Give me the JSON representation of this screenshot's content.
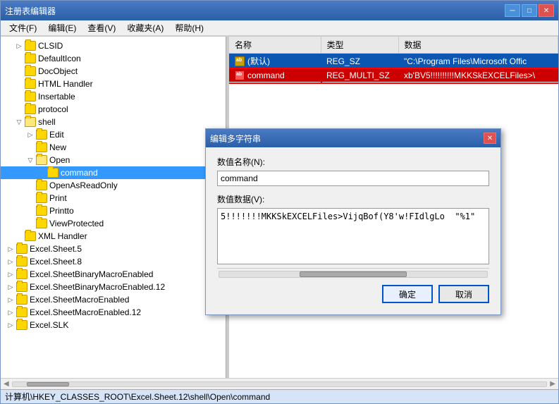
{
  "window": {
    "title": "注册表编辑器",
    "minimize_label": "─",
    "maximize_label": "□",
    "close_label": "✕"
  },
  "menu": {
    "items": [
      {
        "label": "文件(F)"
      },
      {
        "label": "编辑(E)"
      },
      {
        "label": "查看(V)"
      },
      {
        "label": "收藏夹(A)"
      },
      {
        "label": "帮助(H)"
      }
    ]
  },
  "tree": {
    "items": [
      {
        "id": "clsid",
        "label": "CLSID",
        "indent": 1,
        "expanded": false,
        "has_children": true
      },
      {
        "id": "defaulticon",
        "label": "DefaultIcon",
        "indent": 1,
        "expanded": false,
        "has_children": false
      },
      {
        "id": "docobject",
        "label": "DocObject",
        "indent": 1,
        "expanded": false,
        "has_children": false
      },
      {
        "id": "htmlhandler",
        "label": "HTML Handler",
        "indent": 1,
        "expanded": false,
        "has_children": false
      },
      {
        "id": "insertable",
        "label": "Insertable",
        "indent": 1,
        "expanded": false,
        "has_children": false
      },
      {
        "id": "protocol",
        "label": "protocol",
        "indent": 1,
        "expanded": false,
        "has_children": false
      },
      {
        "id": "shell",
        "label": "shell",
        "indent": 1,
        "expanded": true,
        "has_children": true
      },
      {
        "id": "edit",
        "label": "Edit",
        "indent": 2,
        "expanded": false,
        "has_children": true
      },
      {
        "id": "new",
        "label": "New",
        "indent": 2,
        "expanded": false,
        "has_children": false
      },
      {
        "id": "open",
        "label": "Open",
        "indent": 2,
        "expanded": true,
        "has_children": true
      },
      {
        "id": "command",
        "label": "command",
        "indent": 3,
        "expanded": false,
        "has_children": false,
        "selected": true
      },
      {
        "id": "openasreadonly",
        "label": "OpenAsReadOnly",
        "indent": 2,
        "expanded": false,
        "has_children": false
      },
      {
        "id": "print",
        "label": "Print",
        "indent": 2,
        "expanded": false,
        "has_children": false
      },
      {
        "id": "printto",
        "label": "Printto",
        "indent": 2,
        "expanded": false,
        "has_children": false
      },
      {
        "id": "viewprotected",
        "label": "ViewProtected",
        "indent": 2,
        "expanded": false,
        "has_children": false
      },
      {
        "id": "xmlhandler",
        "label": "XML Handler",
        "indent": 1,
        "expanded": false,
        "has_children": false
      },
      {
        "id": "excelsheet5",
        "label": "Excel.Sheet.5",
        "indent": 0,
        "expanded": false,
        "has_children": false
      },
      {
        "id": "excelsheet8",
        "label": "Excel.Sheet.8",
        "indent": 0,
        "expanded": false,
        "has_children": false
      },
      {
        "id": "excelbinary",
        "label": "Excel.SheetBinaryMacroEnabled",
        "indent": 0,
        "expanded": false,
        "has_children": false
      },
      {
        "id": "excelbinary12",
        "label": "Excel.SheetBinaryMacroEnabled.12",
        "indent": 0,
        "expanded": false,
        "has_children": false
      },
      {
        "id": "excelmacro",
        "label": "Excel.SheetMacroEnabled",
        "indent": 0,
        "expanded": false,
        "has_children": false
      },
      {
        "id": "excelmacro12",
        "label": "Excel.SheetMacroEnabled.12",
        "indent": 0,
        "expanded": false,
        "has_children": false
      },
      {
        "id": "excelslk",
        "label": "Excel.SLK",
        "indent": 0,
        "expanded": false,
        "has_children": false
      }
    ]
  },
  "registry_table": {
    "headers": [
      "名称",
      "类型",
      "数据"
    ],
    "rows": [
      {
        "name": "(默认)",
        "type": "REG_SZ",
        "data": "\"C:\\Program Files\\Microsoft Offic",
        "highlighted": true
      },
      {
        "name": "command",
        "type": "REG_MULTI_SZ",
        "data": "xb'BV5!!!!!!!!!!MKKSkEXCELFiles>\\",
        "highlighted_cmd": true
      }
    ]
  },
  "dialog": {
    "title": "编辑多字符串",
    "close_label": "✕",
    "name_label": "数值名称(N):",
    "name_value": "command",
    "data_label": "数值数据(V):",
    "data_value": "5!!!!!!!MKKSkEXCELFiles>VijqBof(Y8'w!FIdlgLo  \"%1\"",
    "ok_label": "确定",
    "cancel_label": "取消"
  },
  "status_bar": {
    "text": "计算机\\HKEY_CLASSES_ROOT\\Excel.Sheet.12\\shell\\Open\\command"
  }
}
